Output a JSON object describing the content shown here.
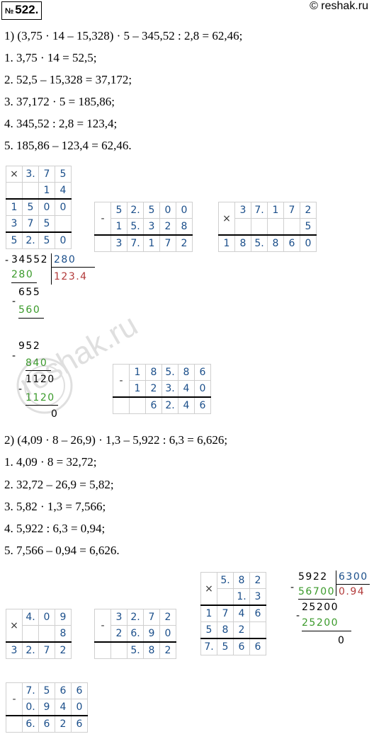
{
  "header": {
    "number_sign": "№",
    "number": "522.",
    "site": "© reshak.ru"
  },
  "part1": {
    "expr": "1) (3,75 · 14 – 15,328) · 5 – 345,52 : 2,8 = 62,46;",
    "steps": [
      "1.  3,75 · 14 = 52,5;",
      "2.  52,5 – 15,328 = 37,172;",
      "3.  37,172 · 5 = 185,86;",
      "4.  345,52 : 2,8 = 123,4;",
      "5.  185,86 – 123,4 = 62,46."
    ],
    "mult1": {
      "op": "×",
      "rows": [
        [
          "",
          "3.",
          "7",
          "5"
        ],
        [
          "",
          "",
          "1",
          "4"
        ],
        [
          "1",
          "5",
          "0",
          "0"
        ],
        [
          "3",
          "7",
          "5",
          ""
        ],
        [
          "5",
          "2.",
          "5",
          "0"
        ]
      ]
    },
    "sub1": {
      "op": "-",
      "rows": [
        [
          "5",
          "2.",
          "5",
          "0",
          "0"
        ],
        [
          "1",
          "5.",
          "3",
          "2",
          "8"
        ],
        [
          "3",
          "7.",
          "1",
          "7",
          "2"
        ]
      ]
    },
    "mult2": {
      "op": "×",
      "rows": [
        [
          "3",
          "7.",
          "1",
          "7",
          "2"
        ],
        [
          "",
          "",
          "",
          "",
          "5"
        ],
        [
          "1",
          "8",
          "5.",
          "8",
          "6",
          "0"
        ]
      ]
    },
    "div": {
      "dividend": "34552",
      "divisor": "280",
      "quotient": "123.4",
      "steps": [
        "280",
        "655",
        "560",
        "952",
        "840",
        "1120",
        "1120",
        "0"
      ]
    },
    "sub2": {
      "op": "-",
      "rows": [
        [
          "1",
          "8",
          "5.",
          "8",
          "6"
        ],
        [
          "1",
          "2",
          "3.",
          "4",
          "0"
        ],
        [
          "",
          "6",
          "2.",
          "4",
          "6"
        ]
      ]
    }
  },
  "part2": {
    "expr": "2) (4,09 · 8 – 26,9) · 1,3 – 5,922 : 6,3 = 6,626;",
    "steps": [
      "1.  4,09 · 8 = 32,72;",
      "2.  32,72 – 26,9 = 5,82;",
      "3.  5,82 · 1,3 = 7,566;",
      "4.  5,922 : 6,3 = 0,94;",
      "5.  7,566 – 0,94 = 6,626."
    ],
    "mult1": {
      "op": "×",
      "rows": [
        [
          "4.",
          "0",
          "9"
        ],
        [
          "",
          "",
          "8"
        ],
        [
          "3",
          "2.",
          "7",
          "2"
        ]
      ]
    },
    "sub1": {
      "op": "-",
      "rows": [
        [
          "3",
          "2.",
          "7",
          "2"
        ],
        [
          "2",
          "6.",
          "9",
          "0"
        ],
        [
          "",
          "5.",
          "8",
          "2"
        ]
      ]
    },
    "mult2": {
      "op": "×",
      "rows": [
        [
          "5.",
          "8",
          "2"
        ],
        [
          "",
          "1.",
          "3"
        ],
        [
          "1",
          "7",
          "4",
          "6"
        ],
        [
          "5",
          "8",
          "2",
          ""
        ],
        [
          "7.",
          "5",
          "6",
          "6"
        ]
      ]
    },
    "div": {
      "dividend": "5922",
      "divisor": "6300",
      "quotient": "0.94",
      "steps": [
        "56700",
        "25200",
        "25200",
        "0"
      ]
    },
    "sub2": {
      "op": "-",
      "rows": [
        [
          "7.",
          "5",
          "6",
          "6"
        ],
        [
          "0.",
          "9",
          "4",
          "0"
        ],
        [
          "6.",
          "6",
          "2",
          "6"
        ]
      ]
    }
  },
  "watermark": "reshak.ru"
}
